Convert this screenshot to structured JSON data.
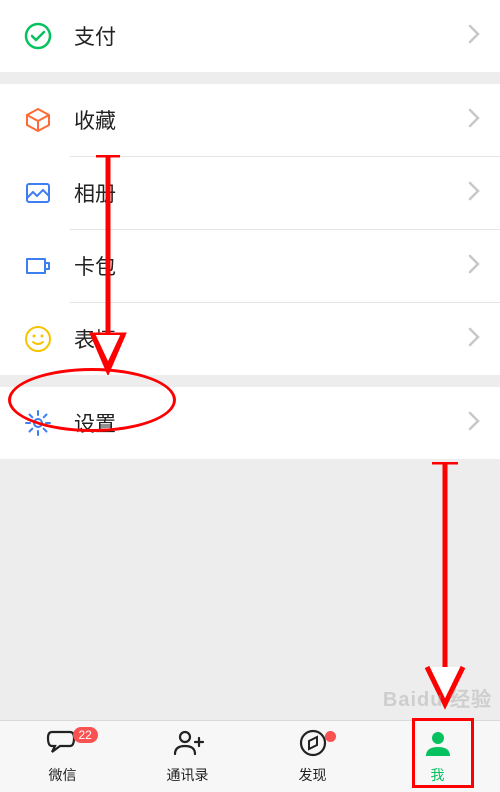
{
  "menu": {
    "pay": "支付",
    "favorites": "收藏",
    "album": "相册",
    "cards": "卡包",
    "stickers": "表情",
    "settings": "设置"
  },
  "tabs": {
    "chats": "微信",
    "contacts": "通讯录",
    "discover": "发现",
    "me": "我",
    "badge_chats": "22"
  },
  "colors": {
    "accent": "#07c160",
    "iconBlue": "#3d7ef0",
    "iconYellow": "#f5c400",
    "iconRed": "#ff0000"
  },
  "watermark": "Baidu 经验"
}
